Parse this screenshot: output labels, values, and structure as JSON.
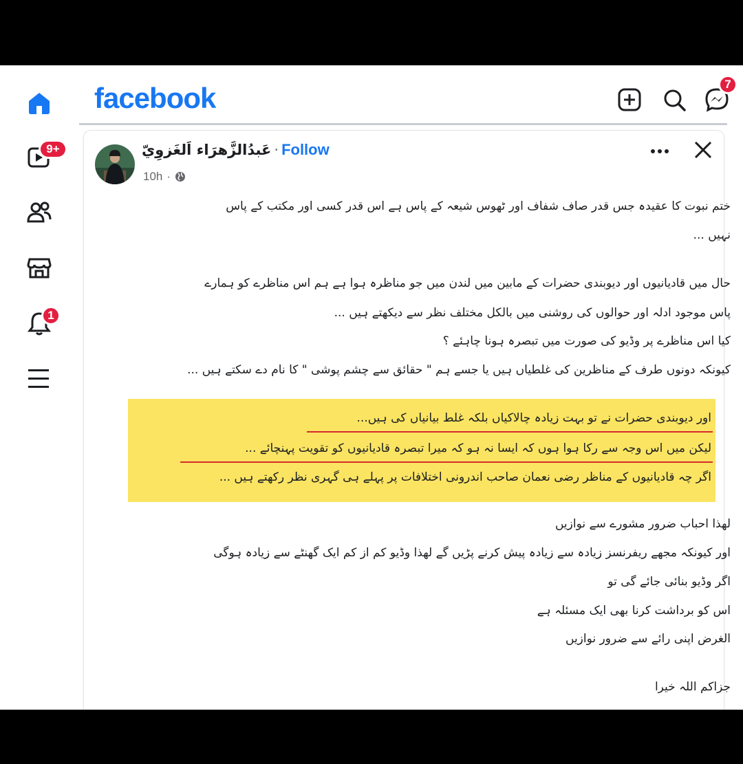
{
  "app": {
    "brand": "facebook",
    "brand_color": "#1877f2"
  },
  "sidebar": {
    "items": [
      {
        "name": "home",
        "icon": "home-icon",
        "active": true
      },
      {
        "name": "video",
        "icon": "video-icon",
        "badge": "9+"
      },
      {
        "name": "friends",
        "icon": "friends-icon"
      },
      {
        "name": "marketplace",
        "icon": "marketplace-icon"
      },
      {
        "name": "notifications",
        "icon": "bell-icon",
        "badge": "1"
      },
      {
        "name": "menu",
        "icon": "menu-icon"
      }
    ]
  },
  "topbar": {
    "messenger_badge": "7"
  },
  "post": {
    "author": "عَبدُالزَّهرَاء اَلغَزوِيّ",
    "separator": "·",
    "follow_label": "Follow",
    "time": "10h",
    "lines": [
      "ختم نبوت کا عقیدہ جس قدر صاف شفاف اور ٹھوس شیعہ کے پاس ہے اس قدر کسی اور مکتب کے پاس",
      "نہیں ...",
      "حال میں قادیانیوں اور دیوبندی حضرات کے مابین  میں  لندن میں جو مناظرہ ہوا ہے ہم اس مناظرے کو  ہمارے",
      "پاس موجود  ادلہ  اور حوالوں  کی روشنی میں بالکل مختلف نظر سے دیکھتے ہیں ...",
      "کیا اس مناظرے پر وڈیو کی صورت میں تبصرہ ہونا چاہئے ؟",
      "کیونکہ دونوں طرف کے مناظرین کی غلطیاں ہیں یا جسے ہم \" حقائق سے چشم پوشی \" کا نام دے سکتے ہیں ...",
      "اور دیوبندی حضرات نے تو بہت زیادہ چالاکیاں بلکہ غلط بیانیاں کی ہیں...",
      "لیکن میں اس وجہ سے رکا ہوا ہوں کہ ایسا نہ ہو کہ میرا تبصرہ قادیانیوں کو تقویت پہنچائے ...",
      "اگر چہ قادیانیوں کے مناظر رضی نعمان صاحب اندرونی اختلافات پر پہلے ہی گہری نظر رکھتے ہیں ...",
      "لھذا احباب ضرور مشورے سے نوازیں",
      "اور کیونکہ مجھے ریفرنسز زیادہ سے زیادہ پیش کرنے پڑیں گے لھذا  وڈیو کم از کم ایک گھنٹے سے زیادہ ہوگی",
      "اگر وڈیو بنائی جائے گی تو",
      "اس کو برداشت کرنا بھی ایک مسئلہ ہے",
      "الغرض اپنی رائے سے ضرور نوازیں",
      "جزاکم اللہ خیرا"
    ]
  },
  "colors": {
    "highlight": "#fae462",
    "underline": "#d52a2a",
    "badge": "#e41e3f"
  }
}
